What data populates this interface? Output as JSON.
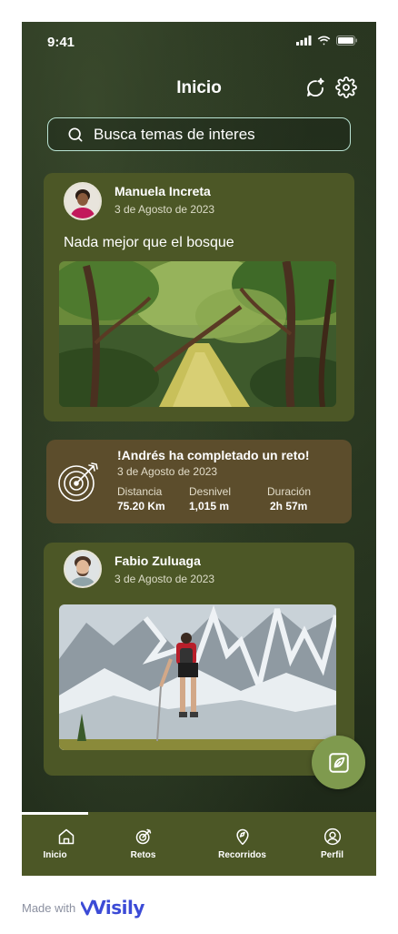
{
  "status_bar": {
    "time": "9:41"
  },
  "header": {
    "title": "Inicio"
  },
  "search": {
    "placeholder": "Busca temas de interes"
  },
  "posts": [
    {
      "author": "Manuela Increta",
      "date": "3 de Agosto de 2023",
      "text": "Nada mejor que el bosque"
    },
    {
      "author": "Fabio Zuluaga",
      "date": "3 de Agosto de 2023",
      "text": ""
    }
  ],
  "challenge": {
    "title": "!Andrés ha completado un reto!",
    "date": "3 de Agosto de 2023",
    "stats": [
      {
        "label": "Distancia",
        "value": "75.20 Km"
      },
      {
        "label": "Desnivel",
        "value": "1,015 m"
      },
      {
        "label": "Duración",
        "value": "2h 57m"
      }
    ]
  },
  "tabbar": {
    "items": [
      {
        "label": "Inicio",
        "icon": "home-icon",
        "active": true
      },
      {
        "label": "Retos",
        "icon": "target-icon",
        "active": false
      },
      {
        "label": "Recorridos",
        "icon": "map-pin-icon",
        "active": false
      },
      {
        "label": "Perfil",
        "icon": "user-icon",
        "active": false
      }
    ]
  },
  "footer": {
    "made_with": "Made with",
    "brand": "Visily"
  },
  "colors": {
    "card": "#4c5726",
    "challenge": "#5c4d2c",
    "fab": "#7f9a4e",
    "search_border": "#b9e3d3"
  }
}
